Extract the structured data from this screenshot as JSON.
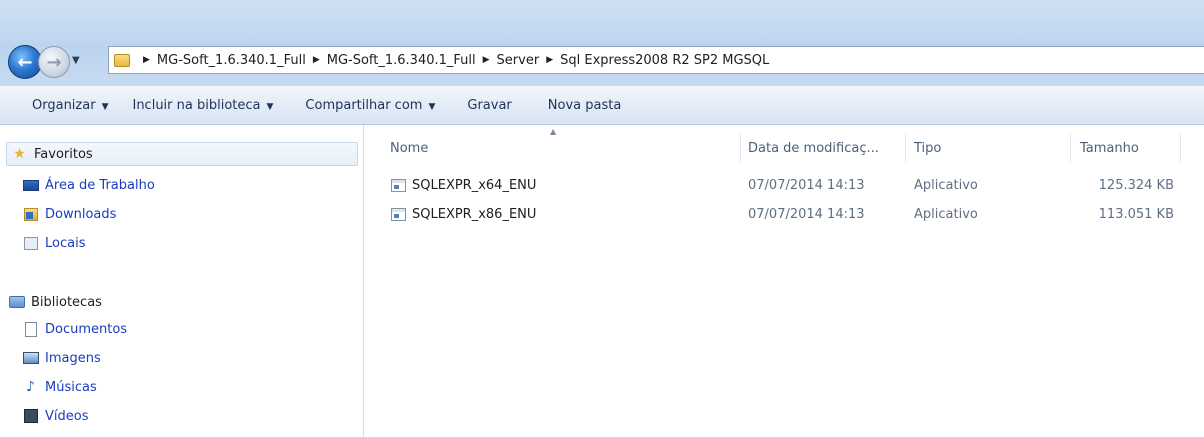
{
  "address_bar": {
    "breadcrumbs": [
      "MG-Soft_1.6.340.1_Full",
      "MG-Soft_1.6.340.1_Full",
      "Server",
      "Sql Express2008 R2 SP2 MGSQL"
    ]
  },
  "commands": {
    "organize": "Organizar",
    "include_library": "Incluir na biblioteca",
    "share_with": "Compartilhar com",
    "burn": "Gravar",
    "new_folder": "Nova pasta"
  },
  "nav": {
    "favorites": "Favoritos",
    "desktop": "Área de Trabalho",
    "downloads": "Downloads",
    "recent": "Locais",
    "libraries": "Bibliotecas",
    "documents": "Documentos",
    "pictures": "Imagens",
    "music": "Músicas",
    "videos": "Vídeos"
  },
  "columns": {
    "name": "Nome",
    "date": "Data de modificaç...",
    "type": "Tipo",
    "size": "Tamanho"
  },
  "files": [
    {
      "name": "SQLEXPR_x64_ENU",
      "date": "07/07/2014 14:13",
      "type": "Aplicativo",
      "size": "125.324 KB"
    },
    {
      "name": "SQLEXPR_x86_ENU",
      "date": "07/07/2014 14:13",
      "type": "Aplicativo",
      "size": "113.051 KB"
    }
  ],
  "icons": [
    "back-arrow-icon",
    "forward-arrow-icon",
    "folder-icon",
    "star-icon",
    "desktop-icon",
    "downloads-icon",
    "recent-places-icon",
    "library-icon",
    "documents-icon",
    "pictures-icon",
    "music-icon",
    "videos-icon",
    "application-icon",
    "sort-arrow-icon"
  ]
}
